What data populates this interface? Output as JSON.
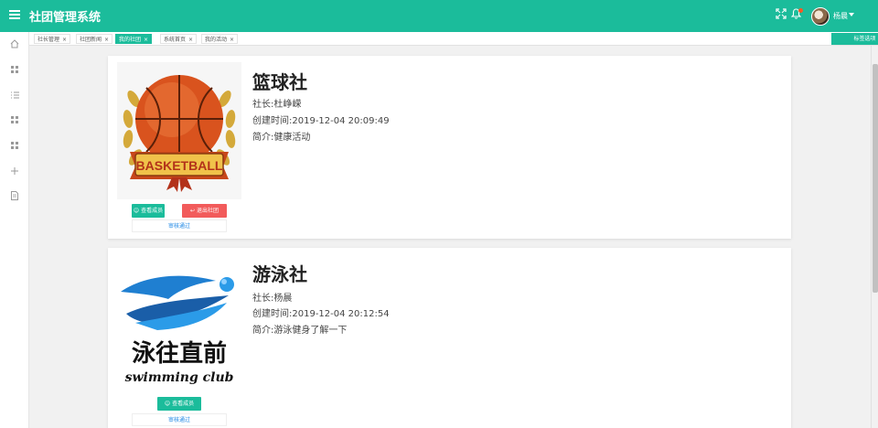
{
  "header": {
    "title": "社团管理系统",
    "menu_icon": "hamburger-icon",
    "fullscreen_icon": "fullscreen-icon",
    "bell_icon": "bell-icon",
    "user_name": "杨晨",
    "accent_color": "#1bbc9b"
  },
  "sidebar": {
    "items": [
      {
        "icon": "home-icon"
      },
      {
        "icon": "grid-icon"
      },
      {
        "icon": "list-icon"
      },
      {
        "icon": "grid-icon"
      },
      {
        "icon": "grid-icon"
      },
      {
        "icon": "plus-icon"
      },
      {
        "icon": "document-icon"
      }
    ]
  },
  "tabs": {
    "items": [
      {
        "label": "社长管理",
        "active": false
      },
      {
        "label": "社团新闻",
        "active": false
      },
      {
        "label": "我的社团",
        "active": true
      },
      {
        "label": "系统首页",
        "active": false
      },
      {
        "label": "我的活动",
        "active": false
      }
    ],
    "close_glyph": "×",
    "menu_label": "标签选项"
  },
  "clubs": [
    {
      "name": "篮球社",
      "leader": "社长:杜峥嵘",
      "created": "创建时间:2019-12-04 20:09:49",
      "intro": "简介:健康活动",
      "image_text": "BASKETBALL",
      "btn_view": "查看成员",
      "btn_quit": "退出社团",
      "status": "审核通过"
    },
    {
      "name": "游泳社",
      "leader": "社长:杨晨",
      "created": "创建时间:2019-12-04 20:12:54",
      "intro": "简介:游泳健身了解一下",
      "image_text_cn": "泳往直前",
      "image_text_en": "swimming club",
      "btn_view": "查看成员",
      "status": "审核通过"
    }
  ]
}
